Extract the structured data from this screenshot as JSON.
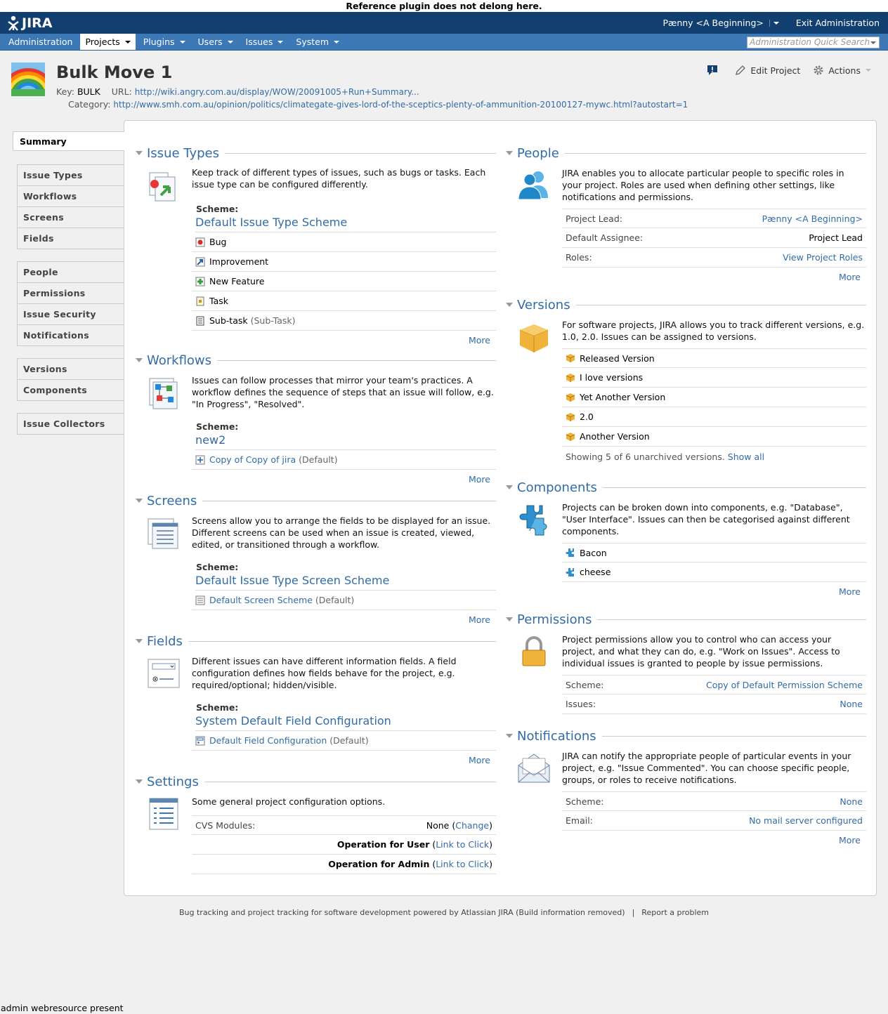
{
  "banner": "Reference plugin does not delong here.",
  "topbar": {
    "logo": "JIRA",
    "user": "Pænny <A Beginning>",
    "exit": "Exit Administration"
  },
  "nav": {
    "items": [
      "Administration",
      "Projects",
      "Plugins",
      "Users",
      "Issues",
      "System"
    ],
    "search_placeholder": "Administration Quick Search"
  },
  "project": {
    "title": "Bulk Move 1",
    "key_label": "Key:",
    "key": "BULK",
    "url_label": "URL:",
    "url": "http://wiki.angry.com.au/display/WOW/20091005+Run+Summary...",
    "category_label": "Category:",
    "category": "http://www.smh.com.au/opinion/politics/climategate-gives-lord-of-the-sceptics-plenty-of-ammunition-20100127-mywc.html?autostart=1",
    "edit": "Edit Project",
    "actions": "Actions"
  },
  "sidebar": {
    "selected": "Summary",
    "group1": [
      "Issue Types",
      "Workflows",
      "Screens",
      "Fields"
    ],
    "group2": [
      "People",
      "Permissions",
      "Issue Security",
      "Notifications"
    ],
    "group3": [
      "Versions",
      "Components"
    ],
    "group4": [
      "Issue Collectors"
    ]
  },
  "issue_types": {
    "title": "Issue Types",
    "desc": "Keep track of different types of issues, such as bugs or tasks. Each issue type can be configured differently.",
    "scheme_label": "Scheme:",
    "scheme": "Default Issue Type Scheme",
    "items": [
      "Bug",
      "Improvement",
      "New Feature",
      "Task",
      "Sub-task"
    ],
    "subtask_note": "(Sub-Task)",
    "more": "More"
  },
  "workflows": {
    "title": "Workflows",
    "desc": "Issues can follow processes that mirror your team's practices. A workflow defines the sequence of steps that an issue will follow, e.g. \"In Progress\", \"Resolved\".",
    "scheme_label": "Scheme:",
    "scheme": "new2",
    "item": "Copy of Copy of jira",
    "item_note": "(Default)",
    "more": "More"
  },
  "screens": {
    "title": "Screens",
    "desc": "Screens allow you to arrange the fields to be displayed for an issue. Different screens can be used when an issue is created, viewed, edited, or transitioned through a workflow.",
    "scheme_label": "Scheme:",
    "scheme": "Default Issue Type Screen Scheme",
    "item": "Default Screen Scheme",
    "item_note": "(Default)",
    "more": "More"
  },
  "fields": {
    "title": "Fields",
    "desc": "Different issues can have different information fields. A field configuration defines how fields behave for the project, e.g. required/optional; hidden/visible.",
    "scheme_label": "Scheme:",
    "scheme": "System Default Field Configuration",
    "item": "Default Field Configuration",
    "item_note": "(Default)",
    "more": "More"
  },
  "settings": {
    "title": "Settings",
    "desc": "Some general project configuration options.",
    "cvs_label": "CVS Modules:",
    "cvs_value": "None",
    "cvs_link": "Change",
    "op_user": "Operation for User",
    "op_admin": "Operation for Admin",
    "op_link": "Link to Click"
  },
  "people": {
    "title": "People",
    "desc": "JIRA enables you to allocate particular people to specific roles in your project. Roles are used when defining other settings, like notifications and permissions.",
    "lead_label": "Project Lead:",
    "lead": "Pænny <A Beginning>",
    "assignee_label": "Default Assignee:",
    "assignee": "Project Lead",
    "roles_label": "Roles:",
    "roles": "View Project Roles",
    "more": "More"
  },
  "versions": {
    "title": "Versions",
    "desc": "For software projects, JIRA allows you to track different versions, e.g. 1.0, 2.0. Issues can be assigned to versions.",
    "items": [
      "Released Version",
      "I love versions",
      "Yet Another Version",
      "2.0",
      "Another Version"
    ],
    "showing": "Showing 5 of 6 unarchived versions.",
    "show_all": "Show all"
  },
  "components": {
    "title": "Components",
    "desc": "Projects can be broken down into components, e.g. \"Database\", \"User Interface\". Issues can then be categorised against different components.",
    "items": [
      "Bacon",
      "cheese"
    ],
    "more": "More"
  },
  "permissions": {
    "title": "Permissions",
    "desc": "Project permissions allow you to control who can access your project, and what they can do, e.g. \"Work on Issues\". Access to individual issues is granted to people by issue permissions.",
    "scheme_label": "Scheme:",
    "scheme": "Copy of Default Permission Scheme",
    "issues_label": "Issues:",
    "issues": "None"
  },
  "notifications": {
    "title": "Notifications",
    "desc": "JIRA can notify the appropriate people of particular events in your project, e.g. \"Issue Commented\". You can choose specific people, groups, or roles to receive notifications.",
    "scheme_label": "Scheme:",
    "scheme": "None",
    "email_label": "Email:",
    "email": "No mail server configured",
    "more": "More"
  },
  "footer": {
    "text": "Bug tracking and project tracking for software development powered by Atlassian JIRA (Build information removed)",
    "sep": "|",
    "report": "Report a problem"
  },
  "bottom_text": "admin webresource present"
}
